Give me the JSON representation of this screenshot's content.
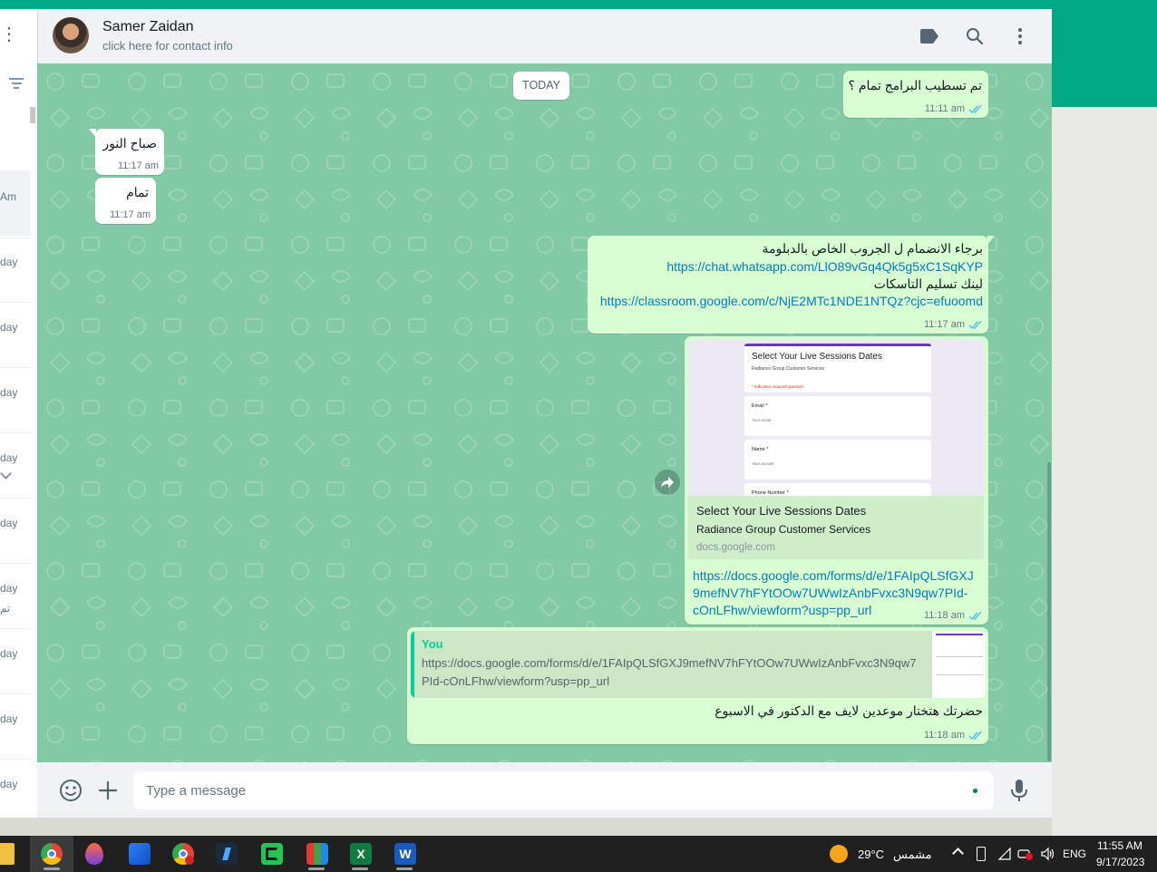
{
  "sidebar": {
    "times": [
      "Am",
      "day",
      "day",
      "day",
      "day",
      "day",
      "day",
      "day",
      "day",
      "day"
    ],
    "snippet": "تم"
  },
  "header": {
    "contact_name": "Samer Zaidan",
    "contact_subtitle": "click here for contact info"
  },
  "chat": {
    "date_divider": "TODAY",
    "messages": [
      {
        "text": "تم تسطيب البرامج تمام ؟",
        "time": "11:11 am"
      },
      {
        "text": "صباح النور",
        "time": "11:17 am"
      },
      {
        "text": "تمام",
        "time": "11:17 am"
      },
      {
        "line1": "برجاء الانضمام ل الجروب الخاص بالدبلومة",
        "link1": "https://chat.whatsapp.com/LlO89vGq4Qk5g5xC1SqKYP",
        "line2": "لينك تسليم التاسكات",
        "link2": "https://classroom.google.com/c/NjE2MTc1NDE1NTQz?cjc=efuoomd",
        "time": "11:17 am"
      },
      {
        "preview": {
          "form_title": "Select Your Live Sessions Dates",
          "form_org": "Radiance Group Customer Services",
          "form_required": "* Indicates required question",
          "field_email": "Email *",
          "field_email_ph": "Your email",
          "field_name": "Name *",
          "field_name_ph": "Your answer",
          "field_phone": "Phone Number *",
          "title": "Select Your Live Sessions Dates",
          "description": "Radiance Group Customer Services",
          "domain": "docs.google.com"
        },
        "link_lines": [
          "https://docs.google.com/forms/d/e/1FAIpQLSfGXJ",
          "9mefNV7hFYtOOw7UWwIzAnbFvxc3N9qw7PId-",
          "cOnLFhw/viewform?usp=pp_url"
        ],
        "time": "11:18 am"
      },
      {
        "quote_author": "You",
        "quote_line1": "https://docs.google.com/forms/d/e/1FAIpQLSfGXJ9mefNV7hFYtOOw7UWwIzAnbFvxc3N9qw7",
        "quote_line2": "PId-cOnLFhw/viewform?usp=pp_url",
        "text": "حضرتك هتختار موعدين لايف مع الدكتور في الاسبوع",
        "time": "11:18 am"
      }
    ]
  },
  "composer": {
    "placeholder": "Type a message"
  },
  "taskbar": {
    "weather_temp": "29°C",
    "weather_text": "مشمس",
    "language": "ENG",
    "time": "11:55 AM",
    "date": "9/17/2023"
  },
  "colors": {
    "accent": "#00a884",
    "chat_bg": "#82c9a6",
    "outgoing": "#d9fdd3",
    "link": "#027eb5",
    "read_tick": "#53bdeb"
  }
}
